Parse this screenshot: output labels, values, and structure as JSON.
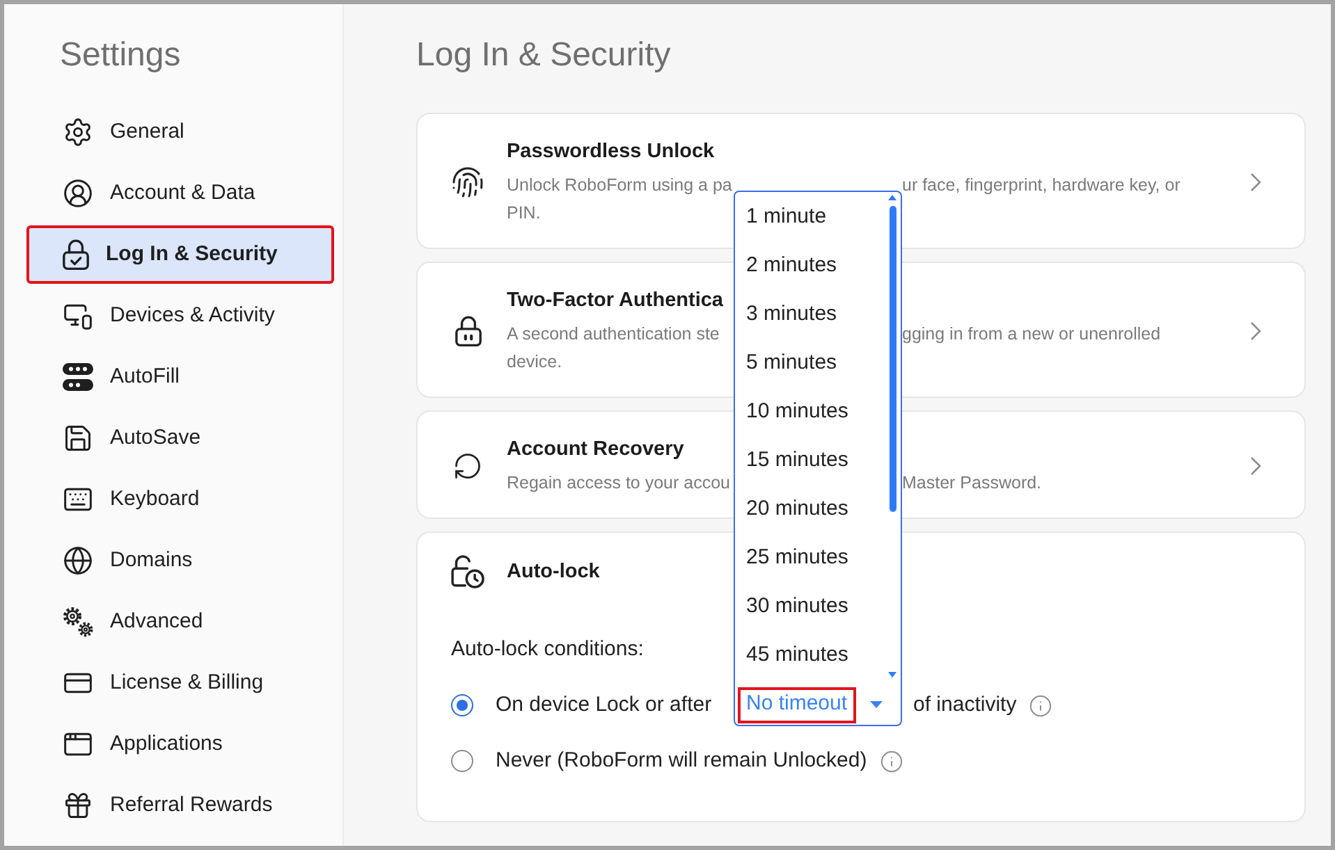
{
  "sidebar": {
    "title": "Settings",
    "items": [
      {
        "label": "General",
        "selected": false,
        "highlighted": false
      },
      {
        "label": "Account & Data",
        "selected": false,
        "highlighted": false
      },
      {
        "label": "Log In & Security",
        "selected": true,
        "highlighted": true
      },
      {
        "label": "Devices & Activity",
        "selected": false,
        "highlighted": false
      },
      {
        "label": "AutoFill",
        "selected": false,
        "highlighted": false
      },
      {
        "label": "AutoSave",
        "selected": false,
        "highlighted": false
      },
      {
        "label": "Keyboard",
        "selected": false,
        "highlighted": false
      },
      {
        "label": "Domains",
        "selected": false,
        "highlighted": false
      },
      {
        "label": "Advanced",
        "selected": false,
        "highlighted": false
      },
      {
        "label": "License & Billing",
        "selected": false,
        "highlighted": false
      },
      {
        "label": "Applications",
        "selected": false,
        "highlighted": false
      },
      {
        "label": "Referral Rewards",
        "selected": false,
        "highlighted": false
      }
    ]
  },
  "page": {
    "title": "Log In & Security"
  },
  "cards": [
    {
      "title": "Passwordless Unlock",
      "description_lines": [
        {
          "left": "Unlock RoboForm using a pa",
          "right": "ur face, fingerprint, hardware key, or"
        },
        {
          "left": "PIN."
        }
      ]
    },
    {
      "title": "Two-Factor Authentica",
      "description_lines": [
        {
          "left": "A second authentication ste",
          "right": "gging in from a new or unenrolled"
        },
        {
          "left": "device."
        }
      ]
    },
    {
      "title": "Account Recovery",
      "description_lines": [
        {
          "left": "Regain access to your accou",
          "right": "Master Password."
        }
      ]
    }
  ],
  "auto_lock": {
    "title": "Auto-lock",
    "conditions_label": "Auto-lock conditions:",
    "options": [
      {
        "kind": "timeout",
        "label": "On device Lock or after",
        "suffix": "of inactivity",
        "selected": true
      },
      {
        "kind": "plain",
        "label": "Never (RoboForm will remain Unlocked)",
        "selected": false
      }
    ],
    "timeout_select": {
      "value": "No timeout",
      "expanded": true,
      "highlighted": true,
      "options": [
        {
          "label": "1 minute",
          "selected": false
        },
        {
          "label": "2 minutes",
          "selected": false
        },
        {
          "label": "3 minutes",
          "selected": false
        },
        {
          "label": "5 minutes",
          "selected": false
        },
        {
          "label": "10 minutes",
          "selected": false
        },
        {
          "label": "15 minutes",
          "selected": false
        },
        {
          "label": "20 minutes",
          "selected": false
        },
        {
          "label": "25 minutes",
          "selected": false
        },
        {
          "label": "30 minutes",
          "selected": false
        },
        {
          "label": "45 minutes",
          "selected": false
        }
      ]
    }
  }
}
